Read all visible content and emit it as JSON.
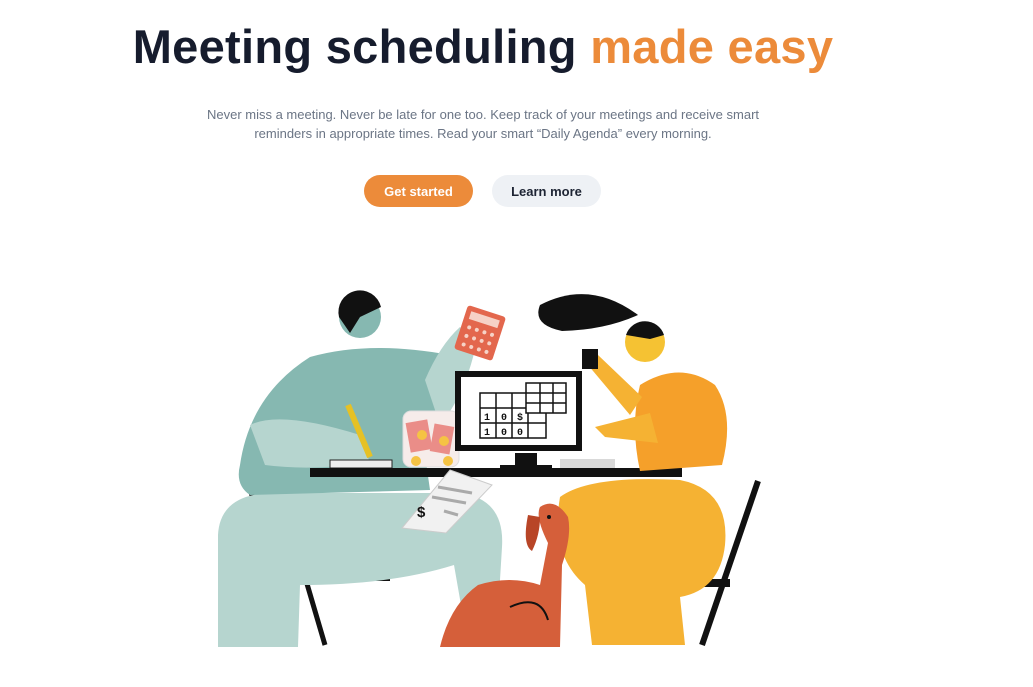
{
  "hero": {
    "title_main": "Meeting scheduling",
    "title_accent": "made easy",
    "subtitle": "Never miss a meeting. Never be late for one too. Keep track of your meetings and receive smart reminders in appropriate times. Read your smart “Daily Agenda” every morning.",
    "primary_cta": "Get started",
    "secondary_cta": "Learn more"
  },
  "illustration": {
    "icon": "meeting-scheduling-illustration",
    "receipt_symbol": "$",
    "monitor_cells": [
      "1",
      "0",
      "$",
      "1",
      "0",
      "0"
    ]
  },
  "colors": {
    "accent": "#ec8b3a",
    "heading": "#161c2d",
    "body_text": "#6b7585",
    "secondary_button": "#eef1f5"
  }
}
